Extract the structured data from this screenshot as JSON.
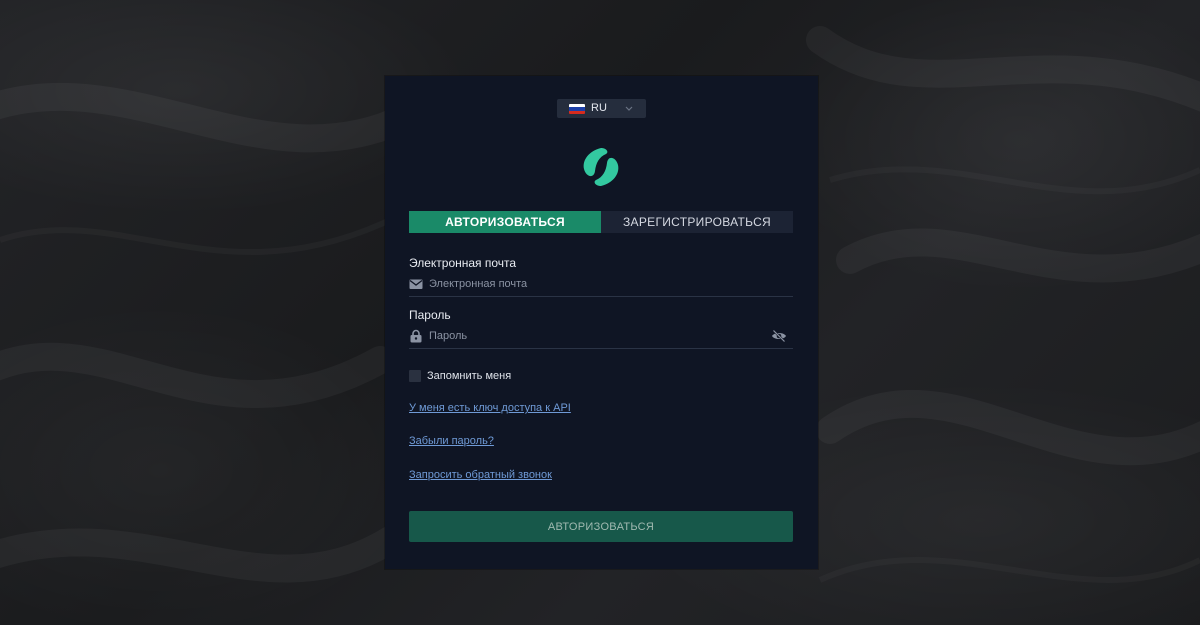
{
  "language": {
    "code": "RU",
    "flag_icon": "russia-flag-icon",
    "flag_colors": [
      "#ffffff",
      "#1c3fa8",
      "#d52b1e"
    ]
  },
  "logo": {
    "icon": "brand-logo-icon",
    "color": "#33c9a0"
  },
  "tabs": [
    {
      "label": "АВТОРИЗОВАТЬСЯ",
      "active": true
    },
    {
      "label": "ЗАРЕГИСТРИРОВАТЬСЯ",
      "active": false
    }
  ],
  "form": {
    "email": {
      "label": "Электронная почта",
      "placeholder": "Электронная почта",
      "value": "",
      "icon": "envelope-icon"
    },
    "password": {
      "label": "Пароль",
      "placeholder": "Пароль",
      "value": "",
      "icon": "lock-icon",
      "toggle_icon": "eye-slash-icon"
    },
    "remember_me": {
      "label": "Запомнить меня",
      "checked": false
    }
  },
  "links": {
    "api_key": "У меня есть ключ доступа к API",
    "forgot_password": "Забыли пароль?",
    "callback": "Запросить обратный звонок"
  },
  "submit_label": "АВТОРИЗОВАТЬСЯ",
  "colors": {
    "accent": "#1a8a68",
    "submit_bg": "#17584a",
    "card_bg": "#0f1524",
    "link": "#6f9ad6"
  }
}
